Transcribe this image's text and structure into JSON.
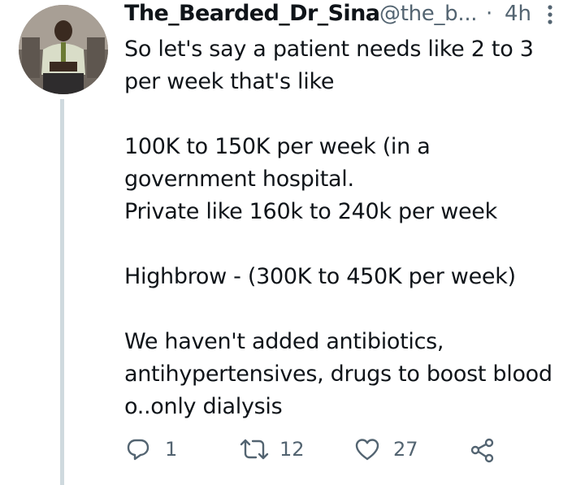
{
  "tweet": {
    "display_name": "The_Bearded_Dr_Sina",
    "handle": "@the_b...",
    "separator": "·",
    "time": "4h",
    "text": "So let's say a patient needs like 2 to 3\nper week that's like\n\n100K to 150K per week (in a\ngovernment hospital.\nPrivate like 160k to 240k per week\n\nHighbrow - (300K to 450K per week)\n\nWe haven't added antibiotics,\nantihypertensives, drugs to boost blood\no..only dialysis",
    "replies": "1",
    "retweets": "12",
    "likes": "27"
  },
  "icons": {
    "avatar": "profile-photo",
    "more": "more-vertical-icon",
    "reply": "reply-icon",
    "retweet": "retweet-icon",
    "like": "heart-icon",
    "share": "share-icon"
  },
  "colors": {
    "text": "#0f1419",
    "secondary": "#536471",
    "thread_line": "#cfd9de"
  }
}
